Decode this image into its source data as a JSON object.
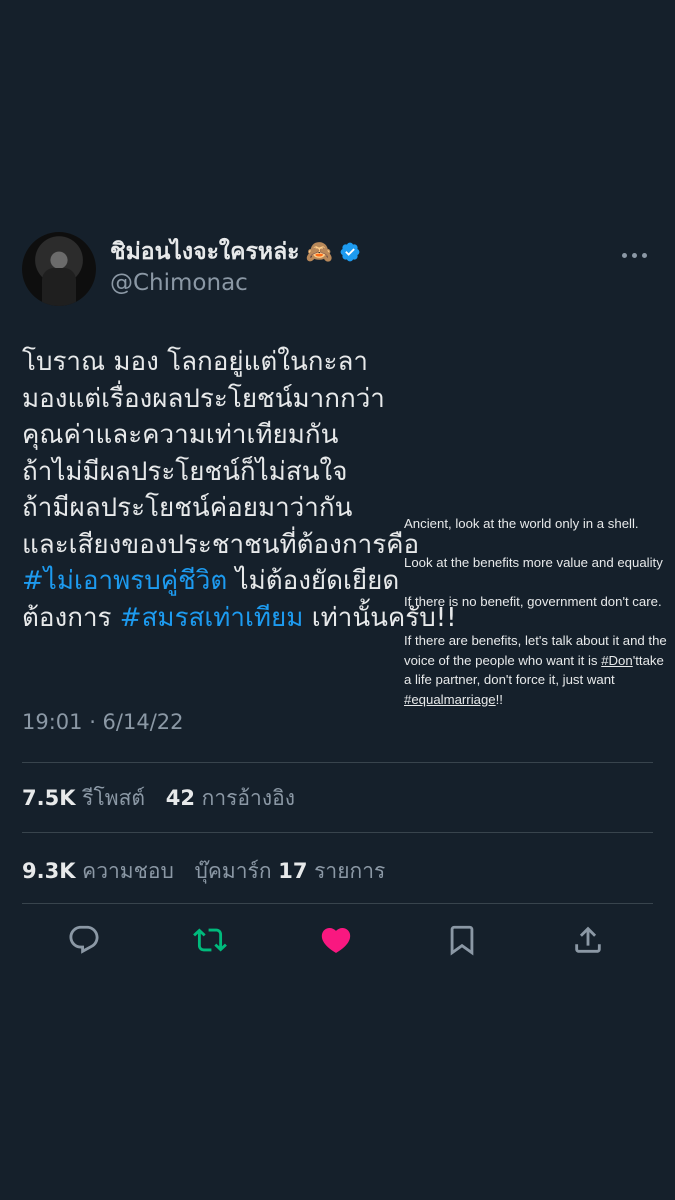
{
  "author": {
    "display_name": "ชิม่อนไงจะใครหล่ะ",
    "emoji": "🙈",
    "handle": "@Chimonac"
  },
  "tweet": {
    "lines": [
      {
        "parts": [
          {
            "text": "โบราณ มอง โลกอยู่แต่ในกะลา",
            "type": "text"
          }
        ]
      },
      {
        "parts": [
          {
            "text": "มองแต่เรื่องผลประโยชน์มากกว่า",
            "type": "text"
          }
        ]
      },
      {
        "parts": [
          {
            "text": "คุณค่าและความเท่าเทียมกัน",
            "type": "text"
          }
        ]
      },
      {
        "parts": [
          {
            "text": "ถ้าไม่มีผลประโยชน์ก็ไม่สนใจ",
            "type": "text"
          }
        ]
      },
      {
        "parts": [
          {
            "text": "ถ้ามีผลประโยชน์ค่อยมาว่ากัน",
            "type": "text"
          }
        ]
      },
      {
        "parts": [
          {
            "text": "และเสียงของประชาชนที่ต้องการคือ",
            "type": "text"
          }
        ]
      },
      {
        "parts": [
          {
            "text": "#ไม่เอาพรบคู่ชีวิต",
            "type": "hashtag"
          },
          {
            "text": " ไม่ต้องยัดเยียด",
            "type": "text"
          }
        ]
      },
      {
        "parts": [
          {
            "text": "ต้องการ ",
            "type": "text"
          },
          {
            "text": "#สมรสเท่าเทียม",
            "type": "hashtag"
          },
          {
            "text": " เท่านั้นครับ!!",
            "type": "text"
          }
        ]
      }
    ],
    "timestamp": "19:01 · 6/14/22"
  },
  "translation": {
    "p1": "Ancient, look at the world only in a shell.",
    "p2": "Look at the benefits more value and equality",
    "p3": "If there is no benefit, government don't care.",
    "p4_a": "If there are benefits, let's talk about it and the voice of the people who want it is ",
    "p4_tag1": "#Don",
    "p4_b": "'ttake a life partner, don't force it, just want ",
    "p4_tag2": "#equalmarriage",
    "p4_c": "!!"
  },
  "stats": {
    "retweets_count": "7.5K",
    "retweets_label": "รีโพสต์",
    "quotes_count": "42",
    "quotes_label": "การอ้างอิง",
    "likes_count": "9.3K",
    "likes_label": "ความชอบ",
    "bookmarks_label": "บุ๊คมาร์ก",
    "bookmarks_count": "17",
    "bookmarks_unit": "รายการ"
  },
  "actions": [
    {
      "name": "reply-icon",
      "color": "#8b98a5"
    },
    {
      "name": "retweet-icon",
      "color": "#00ba7c"
    },
    {
      "name": "like-icon",
      "color": "#f91880"
    },
    {
      "name": "bookmark-icon",
      "color": "#8b98a5"
    },
    {
      "name": "share-icon",
      "color": "#8b98a5"
    }
  ],
  "colors": {
    "background": "#15202b",
    "text": "#e7e9ea",
    "secondary": "#8b98a5",
    "link": "#1d9bf0",
    "verified": "#1d9bf0"
  }
}
